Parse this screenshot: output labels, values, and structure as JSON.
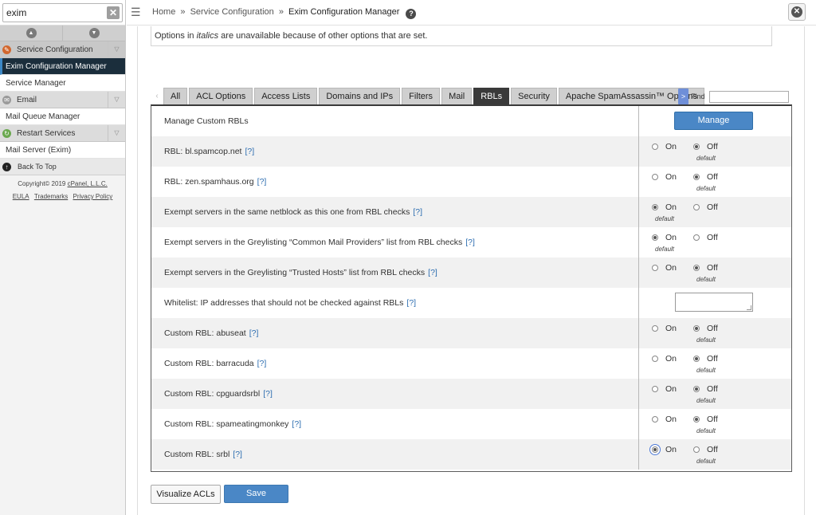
{
  "sidebar": {
    "search_value": "exim",
    "clear_symbol": "✕",
    "collapse_up_symbol": "▲",
    "collapse_down_symbol": "▼",
    "sections": [
      {
        "label": "Service Configuration",
        "icon": "wrench-icon"
      },
      {
        "label": "Email",
        "icon": "email-icon"
      },
      {
        "label": "Restart Services",
        "icon": "restart-icon"
      }
    ],
    "items": {
      "exim_config": "Exim Configuration Manager",
      "service_manager": "Service Manager",
      "mail_queue": "Mail Queue Manager",
      "mail_server": "Mail Server (Exim)"
    },
    "back_to_top": "Back To Top",
    "copyright_prefix": "Copyright© 2019 ",
    "copyright_link": "cPanel, L.L.C.",
    "footer_links": [
      "EULA",
      "Trademarks",
      "Privacy Policy"
    ]
  },
  "header": {
    "menu_symbol": "☰",
    "breadcrumbs": [
      "Home",
      "Service Configuration",
      "Exim Configuration Manager"
    ],
    "separator": "»",
    "help_symbol": "?",
    "close_symbol": "✕"
  },
  "notice": {
    "before": "Options in ",
    "italic": "italics",
    "after": " are unavailable because of other options that are set."
  },
  "tabs": {
    "prev_symbol": "‹",
    "items": [
      "All",
      "ACL Options",
      "Access Lists",
      "Domains and IPs",
      "Filters",
      "Mail",
      "RBLs",
      "Security",
      "Apache SpamAssassin™ Options"
    ],
    "active": "RBLs",
    "next_symbol": ">",
    "find_label": "Find",
    "find_value": ""
  },
  "options": {
    "on_label": "On",
    "off_label": "Off",
    "default_label": "default",
    "help_label": "[?]"
  },
  "settings": [
    {
      "label": "Manage Custom RBLs",
      "control": "button",
      "button_label": "Manage"
    },
    {
      "label": "RBL: bl.spamcop.net",
      "control": "radio",
      "selected": "off",
      "default": "off"
    },
    {
      "label": "RBL: zen.spamhaus.org",
      "control": "radio",
      "selected": "off",
      "default": "off"
    },
    {
      "label": "Exempt servers in the same netblock as this one from RBL checks",
      "control": "radio",
      "selected": "on",
      "default": "on"
    },
    {
      "label": "Exempt servers in the Greylisting “Common Mail Providers” list from RBL checks",
      "control": "radio",
      "selected": "on",
      "default": "on"
    },
    {
      "label": "Exempt servers in the Greylisting “Trusted Hosts” list from RBL checks",
      "control": "radio",
      "selected": "off",
      "default": "off"
    },
    {
      "label": "Whitelist: IP addresses that should not be checked against RBLs",
      "control": "textarea",
      "value": ""
    },
    {
      "label": "Custom RBL: abuseat",
      "control": "radio",
      "selected": "off",
      "default": "off"
    },
    {
      "label": "Custom RBL: barracuda",
      "control": "radio",
      "selected": "off",
      "default": "off"
    },
    {
      "label": "Custom RBL: cpguardsrbl",
      "control": "radio",
      "selected": "off",
      "default": "off"
    },
    {
      "label": "Custom RBL: spameatingmonkey",
      "control": "radio",
      "selected": "off",
      "default": "off"
    },
    {
      "label": "Custom RBL: srbl",
      "control": "radio",
      "selected": "on",
      "default": "off",
      "focused": true
    }
  ],
  "footer": {
    "visualize_label": "Visualize ACLs",
    "save_label": "Save"
  },
  "colors": {
    "accent": "#4a87c6",
    "selected_nav": "#1b2e3c",
    "active_tab": "#3a3a3a"
  }
}
